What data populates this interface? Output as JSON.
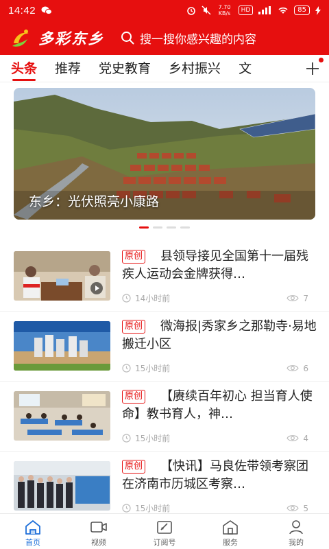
{
  "status": {
    "time": "14:42",
    "network_speed": "7.70 KB/s",
    "hd": "HD",
    "battery": "85"
  },
  "header": {
    "app_name": "多彩东乡",
    "search_placeholder": "搜一搜你感兴趣的内容"
  },
  "tabs": [
    {
      "label": "头条",
      "active": true
    },
    {
      "label": "推荐"
    },
    {
      "label": "党史教育"
    },
    {
      "label": "乡村振兴"
    },
    {
      "label": "文"
    }
  ],
  "banner": {
    "caption": "东乡：光伏照亮小康路",
    "slide_index": 1,
    "slide_count": 4
  },
  "news": [
    {
      "tag": "原创",
      "title": "县领导接见全国第十一届残疾人运动会金牌获得…",
      "time": "14小时前",
      "views": "7",
      "has_video": true
    },
    {
      "tag": "原创",
      "title": "微海报|秀家乡之那勒寺·易地搬迁小区",
      "time": "15小时前",
      "views": "6",
      "has_video": false
    },
    {
      "tag": "原创",
      "title": "【赓续百年初心 担当育人使命】教书育人，神…",
      "time": "15小时前",
      "views": "4",
      "has_video": false
    },
    {
      "tag": "原创",
      "title": "【快讯】马良佐带领考察团在济南市历城区考察…",
      "time": "15小时前",
      "views": "5",
      "has_video": false
    }
  ],
  "bottom_nav": [
    {
      "label": "首页",
      "icon": "home-icon",
      "active": true
    },
    {
      "label": "视频",
      "icon": "video-icon"
    },
    {
      "label": "订阅号",
      "icon": "subscribe-icon"
    },
    {
      "label": "服务",
      "icon": "service-icon"
    },
    {
      "label": "我的",
      "icon": "profile-icon"
    }
  ],
  "colors": {
    "brand_red": "#e60f0f",
    "nav_active": "#1e6fd9"
  }
}
